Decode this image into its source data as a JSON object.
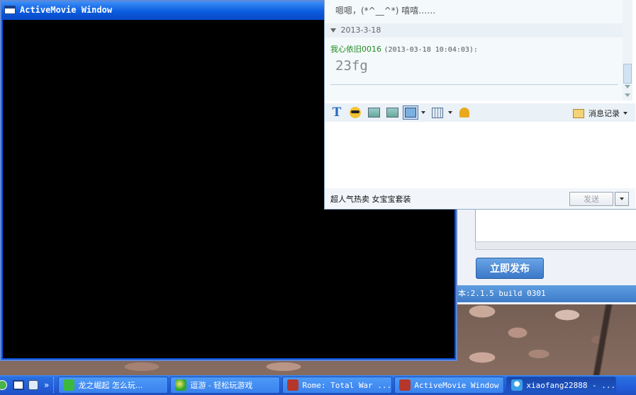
{
  "movie_window": {
    "title": "ActiveMovie Window"
  },
  "chat": {
    "prev_message": "嗯嗯，(*^__^*) 嘻嘻……",
    "date": "2013-3-18",
    "sender_name": "我心依旧0016",
    "sender_time": "(2013-03-18 10:04:03):",
    "message": "23fg",
    "toolbar": {
      "font_icon": "T",
      "history_label": "消息记录"
    },
    "ad_text": "超人气热卖 女宝宝套装",
    "send_label": "发送"
  },
  "background_app": {
    "publish_label": "立即发布",
    "version_text": "本:2.1.5 build 0301"
  },
  "taskbar": {
    "quicklaunch_more": "»",
    "tasks": [
      {
        "label": "龙之崛起 怎么玩..."
      },
      {
        "label": "逗游 - 轻松玩游戏"
      },
      {
        "label": "Rome: Total War ..."
      },
      {
        "label": "ActiveMovie Window"
      },
      {
        "label": "xiaofang22888 - ..."
      }
    ]
  },
  "colors": {
    "taskbar_blue": "#245edb",
    "title_blue": "#0a5ce0",
    "sender_green": "#1e8a1e",
    "publish_blue": "#3b78c8"
  }
}
